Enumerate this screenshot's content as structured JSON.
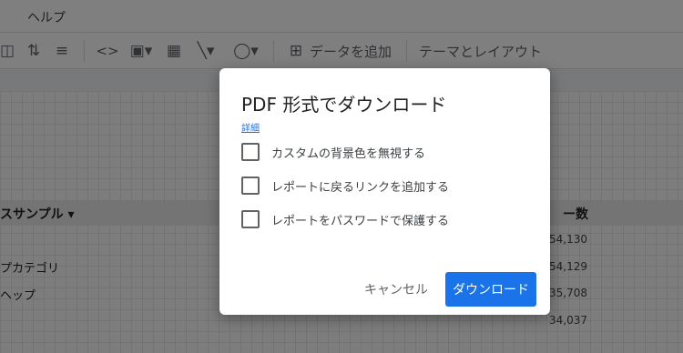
{
  "menubar": {
    "help_label": "ヘルプ"
  },
  "toolbar": {
    "add_data_label": "データを追加",
    "theme_layout_label": "テーマとレイアウト"
  },
  "background_table": {
    "dimension_header": "スサンプル ▾",
    "metric_header": "ー数",
    "rows": [
      {
        "label": "",
        "value": "54,130"
      },
      {
        "label": "プカテゴリ",
        "value": "54,129"
      },
      {
        "label": "ヘップ",
        "value": "35,708"
      },
      {
        "label": "",
        "value": "34,037"
      }
    ]
  },
  "dialog": {
    "title": "PDF 形式でダウンロード",
    "details_link": "詳細",
    "options": [
      {
        "label": "カスタムの背景色を無視する",
        "checked": false
      },
      {
        "label": "レポートに戻るリンクを追加する",
        "checked": false
      },
      {
        "label": "レポートをパスワードで保護する",
        "checked": false
      }
    ],
    "cancel_label": "キャンセル",
    "download_label": "ダウンロード"
  },
  "colors": {
    "primary": "#1a73e8",
    "overlay": "rgba(0,0,0,0.5)"
  }
}
